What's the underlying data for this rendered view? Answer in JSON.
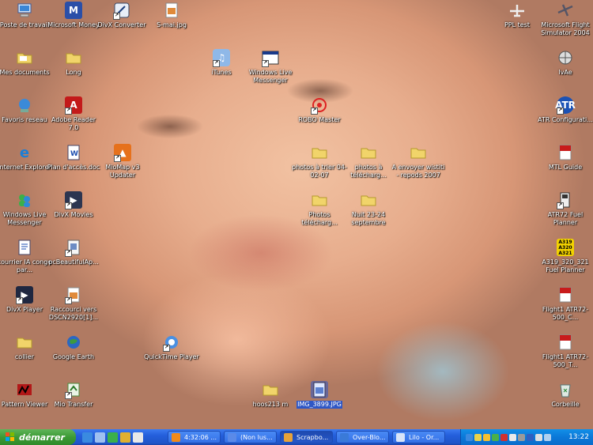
{
  "desktop": {
    "icons": [
      {
        "label": "Poste de travail",
        "icon": "my-computer-icon"
      },
      {
        "label": "Microsoft Money",
        "icon": "money-icon"
      },
      {
        "label": "DivX Converter",
        "icon": "divx-converter-icon"
      },
      {
        "label": "S-mai.jpg",
        "icon": "jpg-file-icon"
      },
      {
        "label": "PPL test",
        "icon": "plane-icon"
      },
      {
        "label": "Microsoft Flight Simulator 2004",
        "icon": "plane-icon"
      },
      {
        "label": "Mes documents",
        "icon": "folder-icon"
      },
      {
        "label": "Long",
        "icon": "folder-icon"
      },
      {
        "label": "iTunes",
        "icon": "itunes-icon"
      },
      {
        "label": "Windows Live Messenger",
        "icon": "messenger-window-icon"
      },
      {
        "label": "IvAe",
        "icon": "ivae-icon"
      },
      {
        "label": "Favoris reseau",
        "icon": "network-icon"
      },
      {
        "label": "Adobe Reader 7.0",
        "icon": "adobe-reader-icon"
      },
      {
        "label": "ROBO Master",
        "icon": "target-icon"
      },
      {
        "label": "ATR Configurati...",
        "icon": "atr-icon"
      },
      {
        "label": "Internet Explorer",
        "icon": "ie-icon"
      },
      {
        "label": "Plan d'accès.doc",
        "icon": "word-doc-icon"
      },
      {
        "label": "MioMap v3 Updater",
        "icon": "miomap-icon"
      },
      {
        "label": "photos à trier 04-02-07",
        "icon": "folder-icon"
      },
      {
        "label": "photos à télécharg...",
        "icon": "folder-icon"
      },
      {
        "label": "A envoyer wistiti - repods 2007",
        "icon": "folder-icon"
      },
      {
        "label": "MTL Guide",
        "icon": "pdf-icon"
      },
      {
        "label": "Windows Live Messenger",
        "icon": "messenger-icon"
      },
      {
        "label": "DivX Movies",
        "icon": "divx-movies-icon"
      },
      {
        "label": "Photos télécharg...",
        "icon": "folder-icon"
      },
      {
        "label": "Nuit 23-24 septembre",
        "icon": "folder-icon"
      },
      {
        "label": "ATR72 Fuel Planner",
        "icon": "fuel-planner-icon"
      },
      {
        "label": "courrier IA conge par...",
        "icon": "document-icon"
      },
      {
        "label": "pcBeautifulAp...",
        "icon": "app-icon"
      },
      {
        "label": "A319_320_321 Fuel Planner",
        "icon": "airbus-fuel-icon"
      },
      {
        "label": "DivX Player",
        "icon": "divx-player-icon"
      },
      {
        "label": "Raccourci vers DSCN2920[1]...",
        "icon": "jpg-file-icon"
      },
      {
        "label": "Flight1 ATR72-500_C...",
        "icon": "pdf-icon"
      },
      {
        "label": "collier",
        "icon": "folder-icon"
      },
      {
        "label": "Google Earth",
        "icon": "google-earth-icon"
      },
      {
        "label": "QuickTime Player",
        "icon": "quicktime-icon"
      },
      {
        "label": "Flight1 ATR72-500_T...",
        "icon": "pdf-icon"
      },
      {
        "label": "Pattern Viewer",
        "icon": "pattern-viewer-icon"
      },
      {
        "label": "Mio Transfer",
        "icon": "mio-transfer-icon"
      },
      {
        "label": "hoos213 m",
        "icon": "folder-icon"
      },
      {
        "label": "IMG_3899.JPG",
        "icon": "jpg-file-icon"
      },
      {
        "label": "Corbeille",
        "icon": "recycle-bin-icon"
      }
    ]
  },
  "taskbar": {
    "start_label": "démarrer",
    "tasks": [
      {
        "label": "4:32:06 ..."
      },
      {
        "label": "(Non lus..."
      },
      {
        "label": "Scrapbo..."
      },
      {
        "label": "Over-Blo..."
      },
      {
        "label": "Lilo - Or..."
      }
    ],
    "clock": "13:22"
  },
  "colors": {
    "taskbar": "#245edb",
    "start": "#3c9a35",
    "tray": "#0b78d8",
    "selection": "#2f57c5"
  }
}
